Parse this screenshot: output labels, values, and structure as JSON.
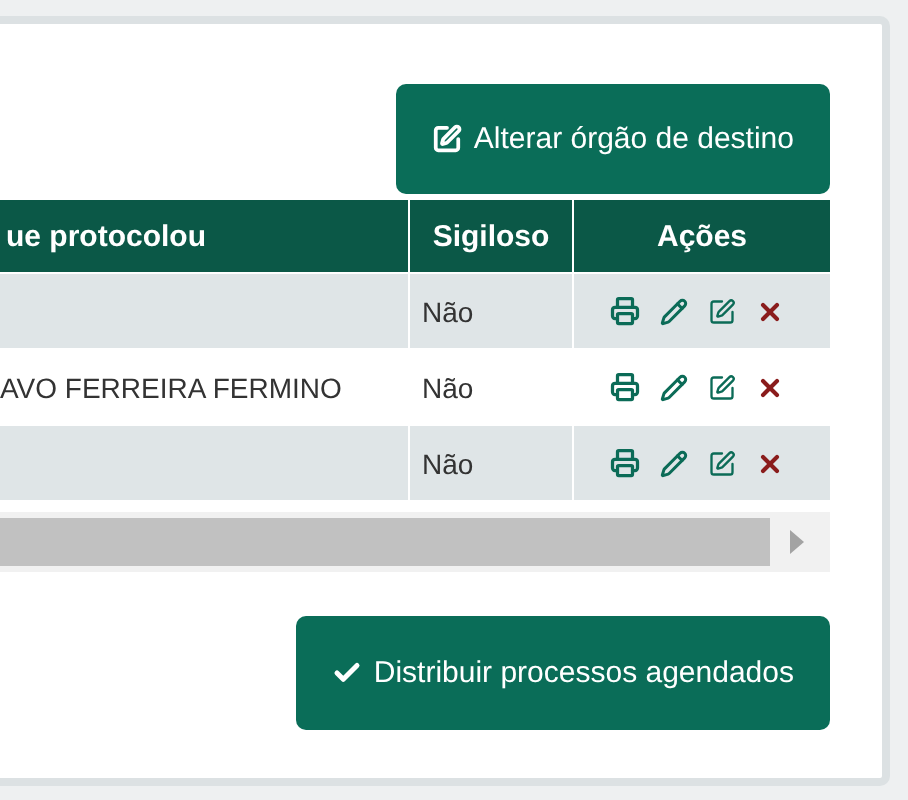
{
  "top_button": {
    "label": "Alterar órgão de destino"
  },
  "table": {
    "columns": [
      "ue protocolou",
      "Sigiloso",
      "Ações"
    ],
    "rows": [
      {
        "sigiloso": "Não"
      },
      {
        "column_1": "AVO FERREIRA FERMINO",
        "sigiloso": "Não"
      },
      {
        "sigiloso": "Não"
      }
    ]
  },
  "bottom_button": {
    "label": "Distribuir processos agendados"
  }
}
